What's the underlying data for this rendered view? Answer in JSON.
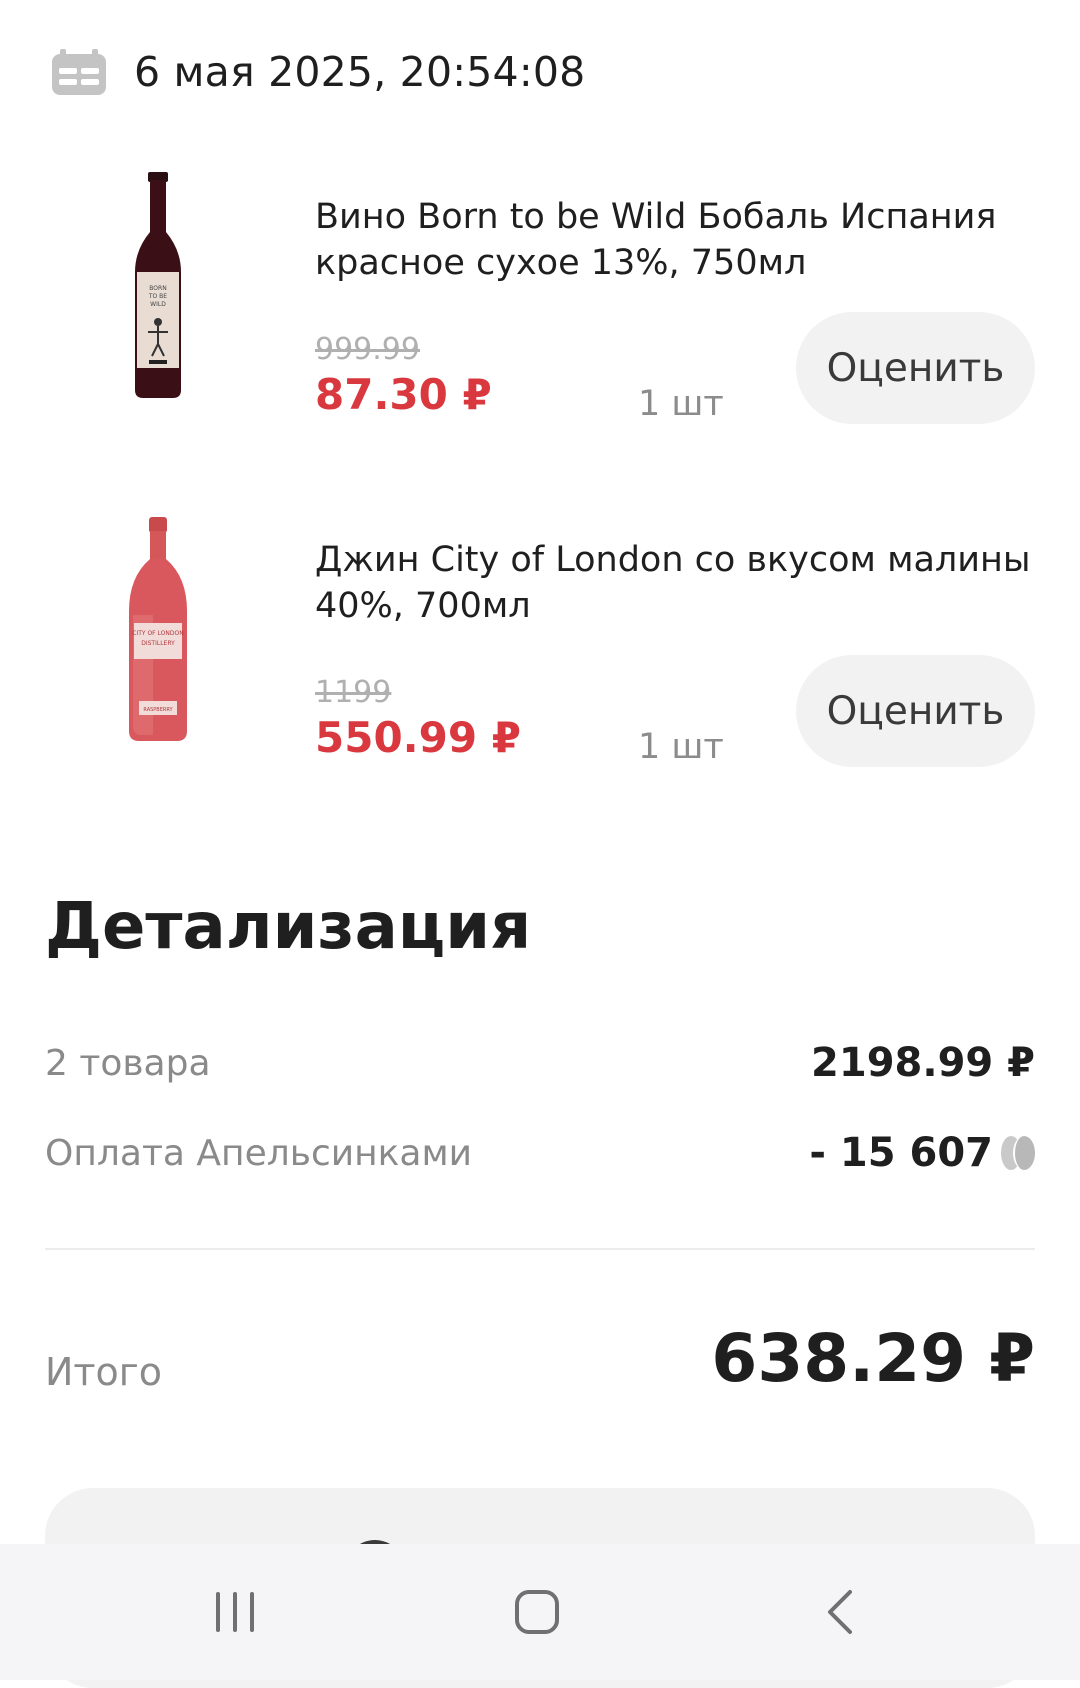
{
  "header": {
    "date": "6 мая 2025, 20:54:08",
    "date_icon": "calendar-icon"
  },
  "items": [
    {
      "title": "Вино Born to be Wild Бобаль Испания красное сухое 13%, 750мл",
      "old_price": "999.99",
      "price": "87.30 ₽",
      "qty": "1 шт",
      "rate_label": "Оценить",
      "image": "wine-bottle"
    },
    {
      "title": "Джин City of London со вкусом малины 40%, 700мл",
      "old_price": "1199",
      "price": "550.99 ₽",
      "qty": "1 шт",
      "rate_label": "Оценить",
      "image": "gin-bottle"
    }
  ],
  "details": {
    "title": "Детализация",
    "rows": [
      {
        "label": "2 товара",
        "value": "2198.99 ₽"
      },
      {
        "label": "Оплата Апельсинками",
        "value": "- 15 607",
        "icon": "coin-icon"
      }
    ],
    "total_label": "Итого",
    "total_value": "638.29 ₽"
  },
  "navbar": {
    "recent": "recent-apps-icon",
    "home": "home-icon",
    "back": "back-icon"
  },
  "colors": {
    "price_red": "#d9383f",
    "button_bg": "#f2f2f2",
    "muted_text": "#8a8a8a"
  }
}
